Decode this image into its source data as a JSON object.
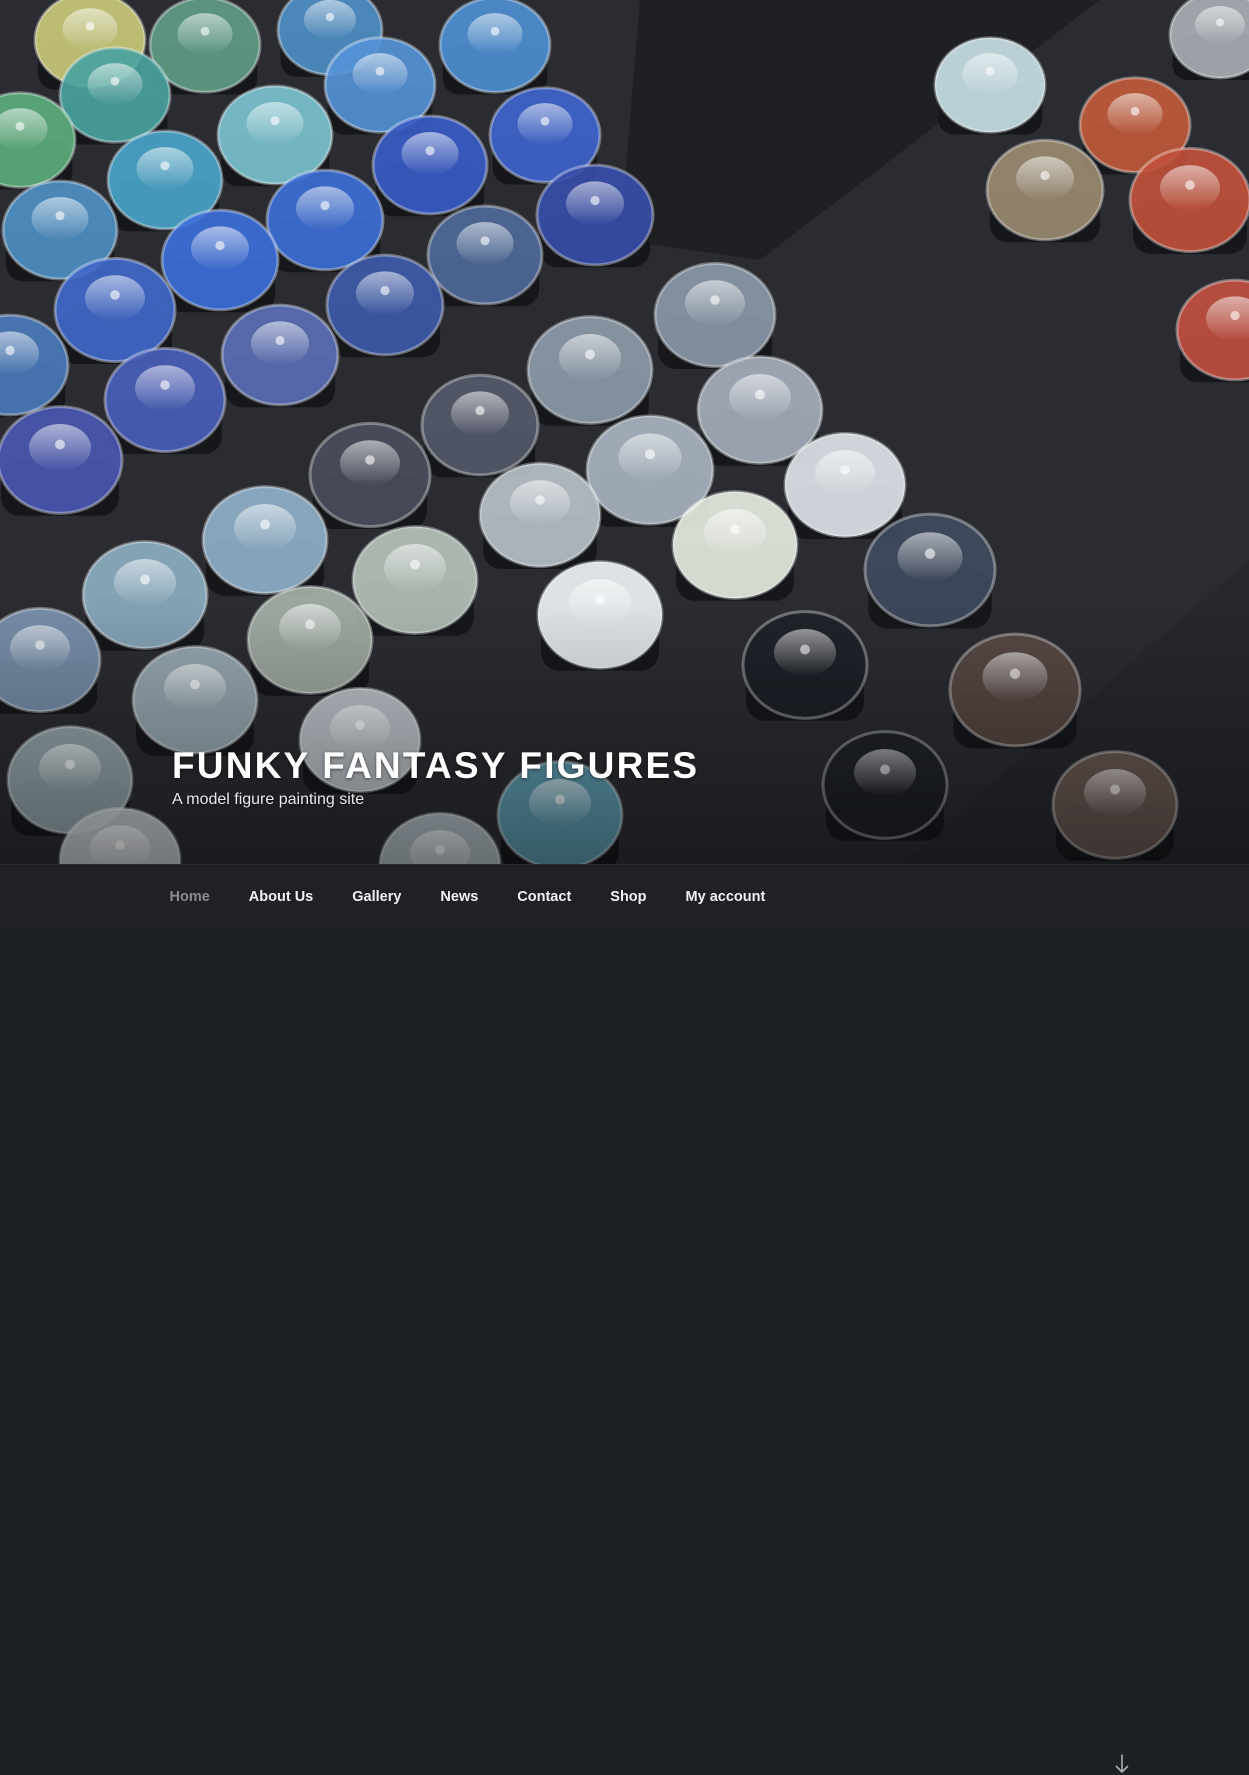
{
  "site": {
    "title": "FUNKY FANTASY FIGURES",
    "description": "A model figure painting site"
  },
  "nav": {
    "items": [
      {
        "label": "Home",
        "current": true
      },
      {
        "label": "About Us",
        "current": false
      },
      {
        "label": "Gallery",
        "current": false
      },
      {
        "label": "News",
        "current": false
      },
      {
        "label": "Contact",
        "current": false
      },
      {
        "label": "Shop",
        "current": false
      },
      {
        "label": "My account",
        "current": false
      }
    ],
    "scroll_icon": "arrow-down-icon"
  },
  "colors": {
    "nav_background": "#1f2125",
    "nav_text": "#f2f2f2",
    "nav_current": "#8a8c90",
    "title_text": "#ffffff"
  }
}
